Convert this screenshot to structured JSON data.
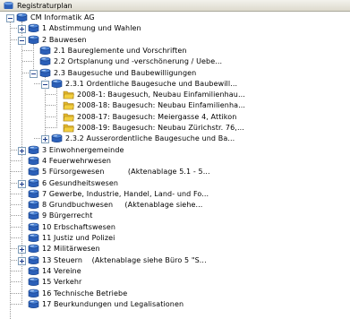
{
  "header": {
    "title": "Registraturplan",
    "icon": "database-icon"
  },
  "tree": [
    {
      "level": 0,
      "type": "db",
      "expander": "minus",
      "label": "CM Informatik AG"
    },
    {
      "level": 1,
      "type": "db",
      "expander": "plus",
      "label": "1 Abstimmung und Wahlen"
    },
    {
      "level": 1,
      "type": "db",
      "expander": "minus",
      "label": "2 Bauwesen"
    },
    {
      "level": 2,
      "type": "db",
      "expander": null,
      "label": "2.1 Baureglemente und Vorschriften"
    },
    {
      "level": 2,
      "type": "db",
      "expander": null,
      "label": "2.2 Ortsplanung und -verschönerung / Uebe..."
    },
    {
      "level": 2,
      "type": "db",
      "expander": "minus",
      "label": "2.3 Baugesuche und Baubewilligungen"
    },
    {
      "level": 3,
      "type": "db",
      "expander": "minus",
      "label": "2.3.1 Ordentliche Baugesuche und Baubewill..."
    },
    {
      "level": 4,
      "type": "folder",
      "expander": null,
      "label": "2008-1: Baugesuch, Neubau Einfamilienhau..."
    },
    {
      "level": 4,
      "type": "folder",
      "expander": null,
      "label": "2008-18: Baugesuch: Neubau Einfamilienha..."
    },
    {
      "level": 4,
      "type": "folder",
      "expander": null,
      "label": "2008-17: Baugesuch: Meiergasse 4, Attikon"
    },
    {
      "level": 4,
      "type": "folder",
      "expander": null,
      "label": "2008-19: Baugesuch: Neubau Zürichstr. 76,..."
    },
    {
      "level": 3,
      "type": "db",
      "expander": "plus",
      "label": "2.3.2 Ausserordentliche Baugesuche und Ba..."
    },
    {
      "level": 1,
      "type": "db",
      "expander": "plus",
      "label": "3 Einwohnergemeinde"
    },
    {
      "level": 1,
      "type": "db",
      "expander": null,
      "label": "4 Feuerwehrwesen"
    },
    {
      "level": 1,
      "type": "db",
      "expander": null,
      "label": "5 Fürsorgewesen          (Aktenablage 5.1 - 5..."
    },
    {
      "level": 1,
      "type": "db",
      "expander": "plus",
      "label": "6 Gesundheitswesen"
    },
    {
      "level": 1,
      "type": "db",
      "expander": null,
      "label": "7 Gewerbe, Industrie, Handel, Land- und Fo..."
    },
    {
      "level": 1,
      "type": "db",
      "expander": null,
      "label": "8 Grundbuchwesen     (Aktenablage siehe..."
    },
    {
      "level": 1,
      "type": "db",
      "expander": null,
      "label": "9 Bürgerrecht"
    },
    {
      "level": 1,
      "type": "db",
      "expander": null,
      "label": "10 Erbschaftswesen"
    },
    {
      "level": 1,
      "type": "db",
      "expander": null,
      "label": "11 Justiz und Polizei"
    },
    {
      "level": 1,
      "type": "db",
      "expander": "plus",
      "label": "12 Militärwesen"
    },
    {
      "level": 1,
      "type": "db",
      "expander": "plus",
      "label": "13 Steuern    (Aktenablage siehe Büro 5 \"S..."
    },
    {
      "level": 1,
      "type": "db",
      "expander": null,
      "label": "14 Vereine"
    },
    {
      "level": 1,
      "type": "db",
      "expander": null,
      "label": "15 Verkehr"
    },
    {
      "level": 1,
      "type": "db",
      "expander": null,
      "label": "16 Technische Betriebe"
    },
    {
      "level": 1,
      "type": "db",
      "expander": null,
      "label": "17 Beurkundungen und Legalisationen"
    }
  ],
  "colors": {
    "db_top": "#4f86d8",
    "db_body": "#2b5fb8",
    "folder": "#f2cf3f"
  }
}
